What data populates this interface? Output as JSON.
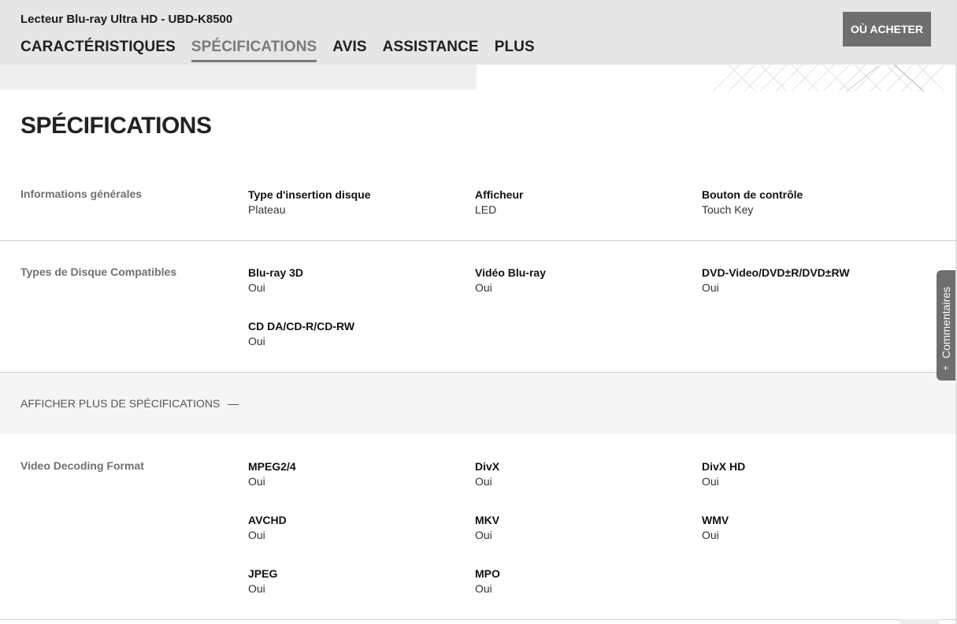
{
  "header": {
    "product_title": "Lecteur Blu-ray Ultra HD - UBD-K8500",
    "tabs": [
      {
        "label": "CARACTÉRISTIQUES",
        "active": false
      },
      {
        "label": "SPÉCIFICATIONS",
        "active": true
      },
      {
        "label": "AVIS",
        "active": false
      },
      {
        "label": "ASSISTANCE",
        "active": false
      },
      {
        "label": "PLUS",
        "active": false
      }
    ],
    "buy_button": "OÙ ACHETER"
  },
  "page_title": "SPÉCIFICATIONS",
  "sections": {
    "general": {
      "title": "Informations générales",
      "specs": [
        {
          "key": "Type d'insertion disque",
          "value": "Plateau"
        },
        {
          "key": "Afficheur",
          "value": "LED"
        },
        {
          "key": "Bouton de contrôle",
          "value": "Touch Key"
        }
      ]
    },
    "discs": {
      "title": "Types de Disque Compatibles",
      "specs": [
        {
          "key": "Blu-ray 3D",
          "value": "Oui"
        },
        {
          "key": "Vidéo Blu-ray",
          "value": "Oui"
        },
        {
          "key": "DVD-Video/DVD±R/DVD±RW",
          "value": "Oui"
        },
        {
          "key": "CD DA/CD-R/CD-RW",
          "value": "Oui"
        }
      ]
    },
    "video": {
      "title": "Video Decoding Format",
      "specs": [
        {
          "key": "MPEG2/4",
          "value": "Oui"
        },
        {
          "key": "DivX",
          "value": "Oui"
        },
        {
          "key": "DivX HD",
          "value": "Oui"
        },
        {
          "key": "AVCHD",
          "value": "Oui"
        },
        {
          "key": "MKV",
          "value": "Oui"
        },
        {
          "key": "WMV",
          "value": "Oui"
        },
        {
          "key": "JPEG",
          "value": "Oui"
        },
        {
          "key": "MPO",
          "value": "Oui"
        }
      ]
    }
  },
  "show_more": "AFFICHER PLUS DE SPÉCIFICATIONS",
  "feedback_tab": "Commentaires",
  "feedback_plus": "+",
  "colors": {
    "header_bg": "#e6e6e6",
    "button_bg": "#6e6e6e",
    "active_tab": "#7a7a7a"
  }
}
